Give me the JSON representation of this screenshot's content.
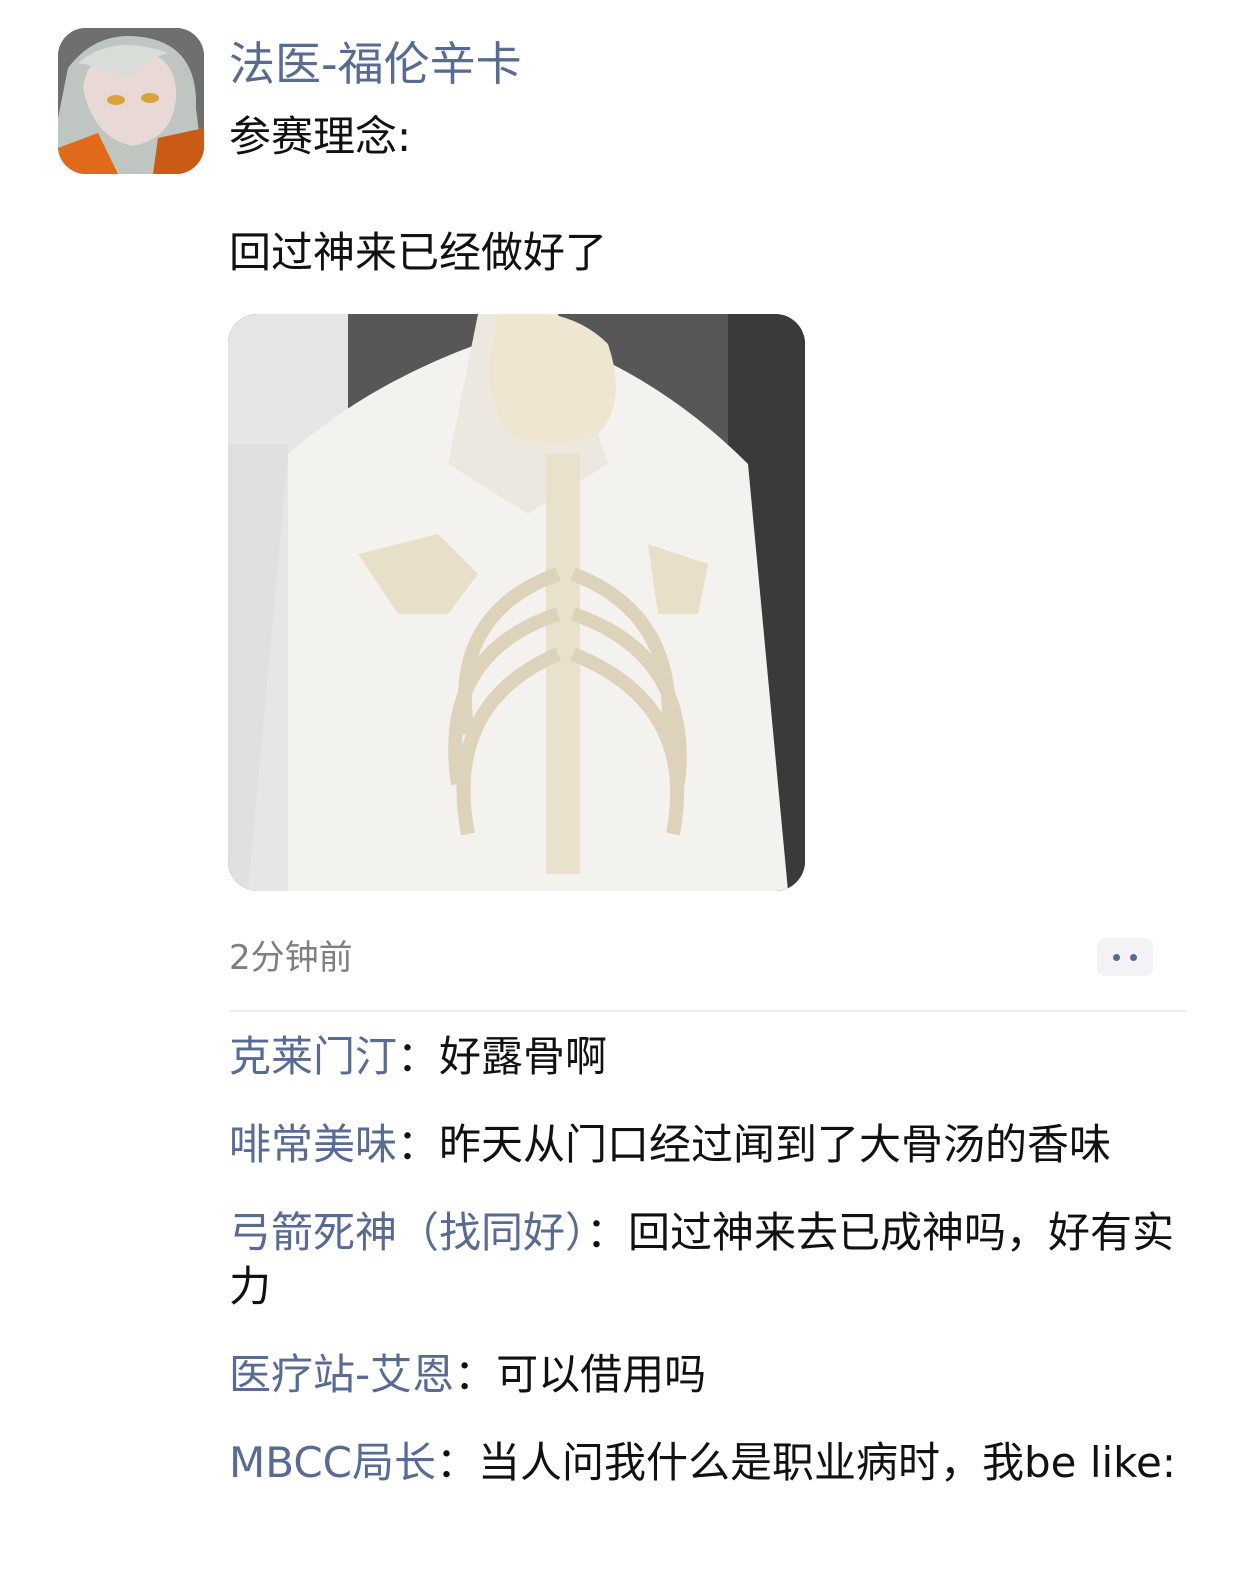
{
  "post": {
    "author": "法医-福伦辛卡",
    "text_lines": [
      "参赛理念:",
      "",
      "回过神来已经做好了"
    ],
    "timestamp": "2分钟前"
  },
  "comments": [
    {
      "author": "克莱门汀",
      "sep": "：",
      "text": "好露骨啊"
    },
    {
      "author": "啡常美味",
      "sep": "：",
      "text": "昨天从门口经过闻到了大骨汤的香味"
    },
    {
      "author": "弓箭死神（找同好）",
      "sep": "：",
      "text": "回过神来去已成神吗，好有实力"
    },
    {
      "author": "医疗站-艾恩",
      "sep": "：",
      "text": "可以借用吗"
    },
    {
      "author": "MBCC局长",
      "sep": "：",
      "text": "当人问我什么是职业病时，我be like:"
    }
  ],
  "colors": {
    "name_link": "#576b95",
    "timestamp": "#7f7f7f",
    "more_button_bg": "#f3f3f5"
  },
  "icons": {
    "more": "more-dots-icon"
  }
}
